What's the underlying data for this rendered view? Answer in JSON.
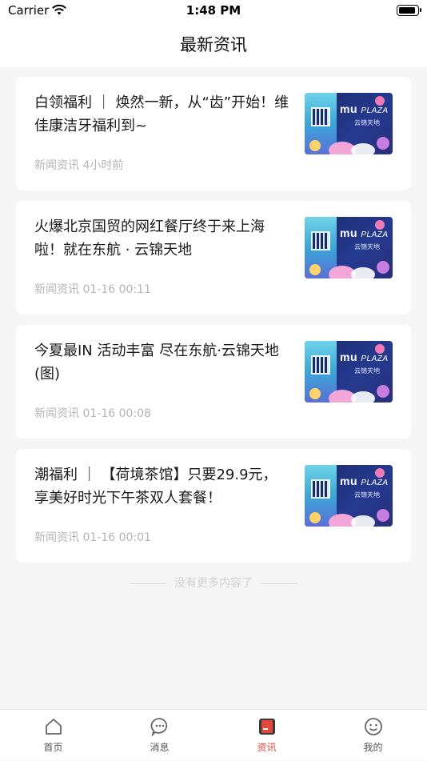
{
  "status_bar": {
    "carrier": "Carrier",
    "time": "1:48 PM"
  },
  "header": {
    "title": "最新资讯"
  },
  "news": [
    {
      "title": "白领福利 ｜ 焕然一新，从“齿”开始！维佳康洁牙福利到~",
      "category": "新闻资讯",
      "time": "4小时前"
    },
    {
      "title": "火爆北京国贸的网红餐厅终于来上海啦！就在东航 · 云锦天地",
      "category": "新闻资讯",
      "time": "01-16 00:11"
    },
    {
      "title": "今夏最IN 活动丰富 尽在东航·云锦天地(图)",
      "category": "新闻资讯",
      "time": "01-16 00:08"
    },
    {
      "title": "潮福利 ｜ 【荷境茶馆】只要29.9元，享美好时光下午茶双人套餐！",
      "category": "新闻资讯",
      "time": "01-16 00:01"
    }
  ],
  "thumbnail": {
    "brand": "mu",
    "brand_suffix": "PLAZA",
    "brand_cn": "云锦天地"
  },
  "footer_note": "没有更多内容了",
  "tab_bar": {
    "tabs": [
      {
        "label": "首页",
        "icon": "home-icon"
      },
      {
        "label": "消息",
        "icon": "message-icon"
      },
      {
        "label": "资讯",
        "icon": "news-icon"
      },
      {
        "label": "我的",
        "icon": "profile-icon"
      }
    ],
    "active": "资讯",
    "active_color": "#e2463d"
  }
}
